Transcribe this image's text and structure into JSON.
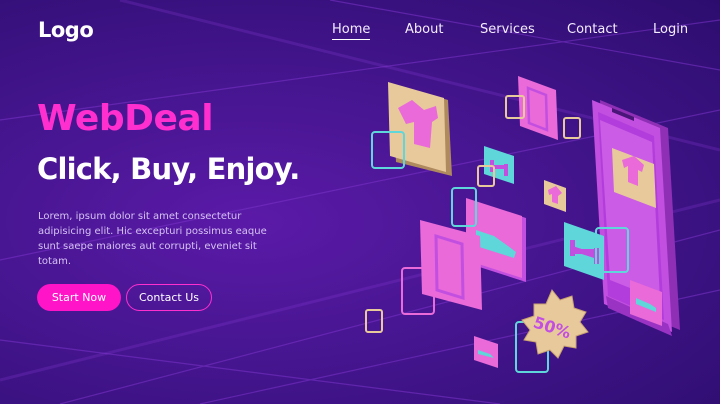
{
  "logo": "Logo",
  "nav": {
    "items": [
      {
        "label": "Home",
        "active": true
      },
      {
        "label": "About"
      },
      {
        "label": "Services"
      },
      {
        "label": "Contact"
      },
      {
        "label": "Login"
      }
    ]
  },
  "hero": {
    "brand": "WebDeal",
    "tagline": "Click, Buy, Enjoy.",
    "body": "Lorem, ipsum dolor sit amet consectetur adipisicing elit. Hic excepturi possimus eaque sunt saepe maiores aut corrupti, eveniet sit totam.",
    "primary_button": "Start Now",
    "secondary_button": "Contact Us"
  },
  "illustration": {
    "badge": "50%"
  },
  "colors": {
    "accent": "#ff14c8",
    "background": "#45158f",
    "tile_tan": "#e8c99c",
    "tile_pink": "#e96ad8",
    "tile_cyan": "#5fd6d9",
    "phone": "#c24fe0"
  }
}
